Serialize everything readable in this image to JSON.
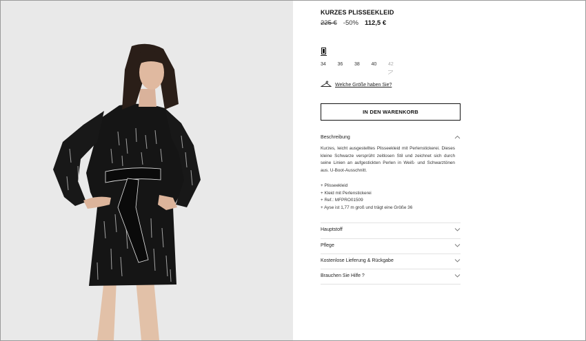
{
  "product": {
    "title": "KURZES PLISSEEKLEID",
    "old_price": "225 €",
    "discount": "-50%",
    "price": "112,5 €"
  },
  "sizes": [
    {
      "label": "34",
      "available": true
    },
    {
      "label": "36",
      "available": true
    },
    {
      "label": "38",
      "available": true
    },
    {
      "label": "40",
      "available": true
    },
    {
      "label": "42",
      "available": false
    }
  ],
  "size_guide": {
    "label": "Welche Größe haben Sie?",
    "icon": "hanger-icon"
  },
  "cart_button": {
    "label": "IN DEN WARENKORB"
  },
  "description": {
    "label": "Beschreibung",
    "text": "Kurzes, leicht ausgestelltes Plisseekleid mit Perlenstickerei. Dieses kleine Schwarze versprüht zeitlosen Stil und zeichnet sich durch seine Linien an aufgestickten Perlen in Weiß- und Schwarztönen aus. U-Boot-Ausschnitt.",
    "bullets": [
      "Plisseekleid",
      "Kleid mit Perlenstickerei",
      "Ref.: MFPRO01509",
      "Ayse ist 1,77 m groß und trägt eine Größe 36"
    ]
  },
  "accordion": [
    {
      "label": "Hauptstoff"
    },
    {
      "label": "Pflege"
    },
    {
      "label": "Kostenlose Lieferung & Rückgabe"
    },
    {
      "label": "Brauchen Sie Hilfe ?"
    }
  ],
  "colors": {
    "photo_bg": "#ebebeb",
    "text": "#111111",
    "divider": "#e2e2e2"
  }
}
